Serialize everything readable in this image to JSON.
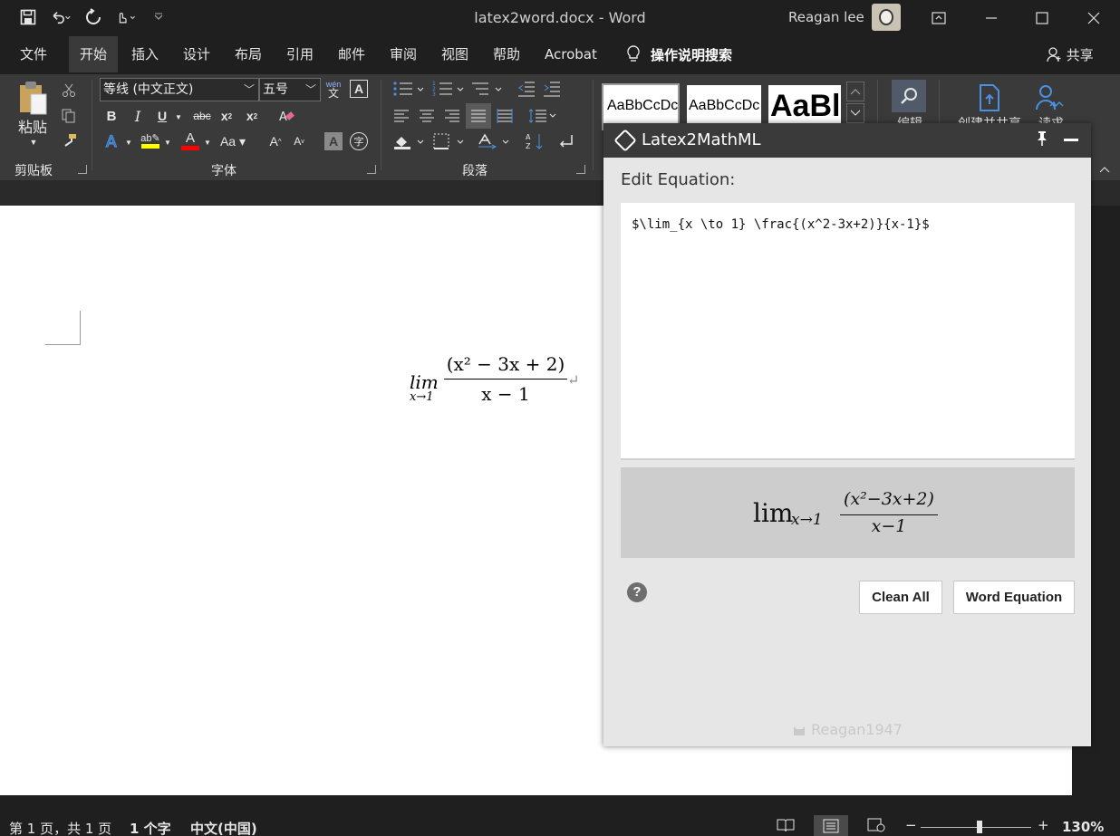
{
  "window": {
    "title": "latex2word.docx  -  Word",
    "user": "Reagan lee"
  },
  "tabs": [
    "文件",
    "开始",
    "插入",
    "设计",
    "布局",
    "引用",
    "邮件",
    "审阅",
    "视图",
    "帮助",
    "Acrobat"
  ],
  "active_tab": "开始",
  "tell_me": "操作说明搜索",
  "share_label": "共享",
  "ribbon": {
    "clipboard": {
      "paste_label": "粘贴",
      "group_label": "剪贴板"
    },
    "font": {
      "font_name": "等线 (中文正文)",
      "font_size": "五号",
      "group_label": "字体",
      "phonetic": "wén"
    },
    "paragraph": {
      "group_label": "段落"
    },
    "styles": [
      "AaBbCcDc",
      "AaBbCcDc",
      "AaBl"
    ],
    "editing_label": "编辑",
    "share_group_label": "创建并共享",
    "read_label": "读求"
  },
  "document": {
    "equation": {
      "lim": "lim",
      "sub": "x→1",
      "numerator": "(x² − 3x + 2)",
      "denominator": "x − 1"
    }
  },
  "pane": {
    "title": "Latex2MathML",
    "edit_label": "Edit Equation:",
    "latex": "$\\lim_{x \\to 1} \\frac{(x^2-3x+2)}{x-1}$",
    "preview": {
      "lim": "lim",
      "sub": "x→1",
      "numerator": "(x²−3x+2)",
      "denominator": "x−1"
    },
    "help": "?",
    "clean_label": "Clean All",
    "word_eq_label": "Word Equation",
    "footer": "Reagan1947"
  },
  "status": {
    "page": "第 1 页，共 1 页",
    "words": "1 个字",
    "language": "中文(中国)",
    "zoom": "130%",
    "zoom_minus": "−",
    "zoom_plus": "+"
  },
  "colors": {
    "chrome": "#1f1f1f",
    "ribbon": "#3a3a3a",
    "highlight_yellow": "#ffff00",
    "font_red": "#ff0000",
    "accent_blue": "#4a90e2"
  }
}
